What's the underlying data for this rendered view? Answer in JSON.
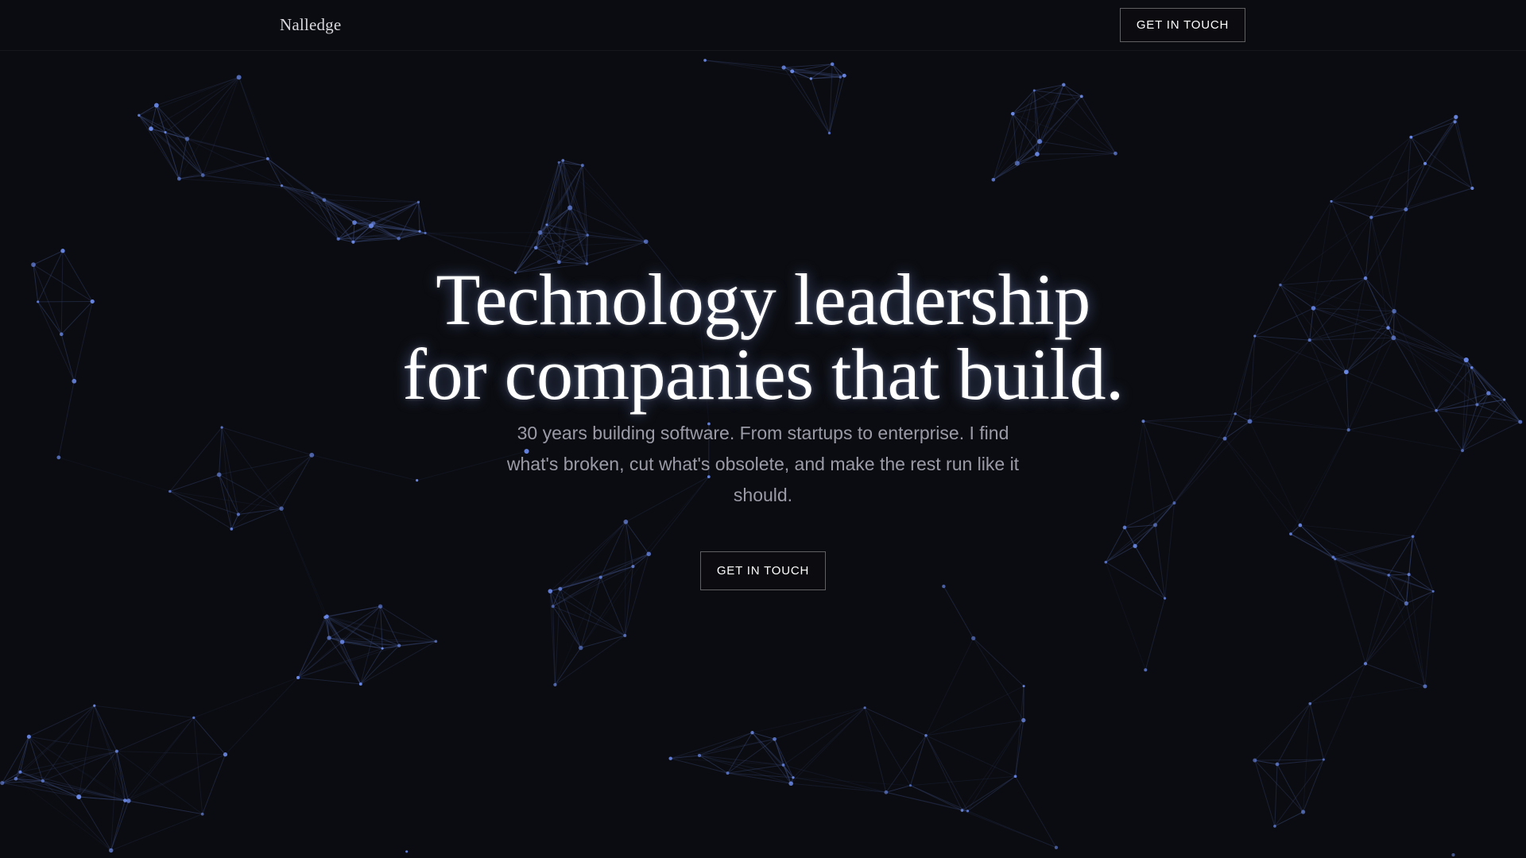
{
  "header": {
    "brand": "Nalledge",
    "cta_label": "GET IN TOUCH"
  },
  "hero": {
    "title_line1": "Technology leadership",
    "title_line2": "for companies that build.",
    "subtitle": "30 years building software. From startups to enterprise. I find what's broken, cut what's obsolete, and make the rest run like it should.",
    "cta_label": "GET IN TOUCH"
  },
  "colors": {
    "background": "#0b0c11",
    "node": "#6e8ef0",
    "edge": "#3a4a7a",
    "text_primary": "#ffffff",
    "text_secondary": "#9a9ba6"
  }
}
